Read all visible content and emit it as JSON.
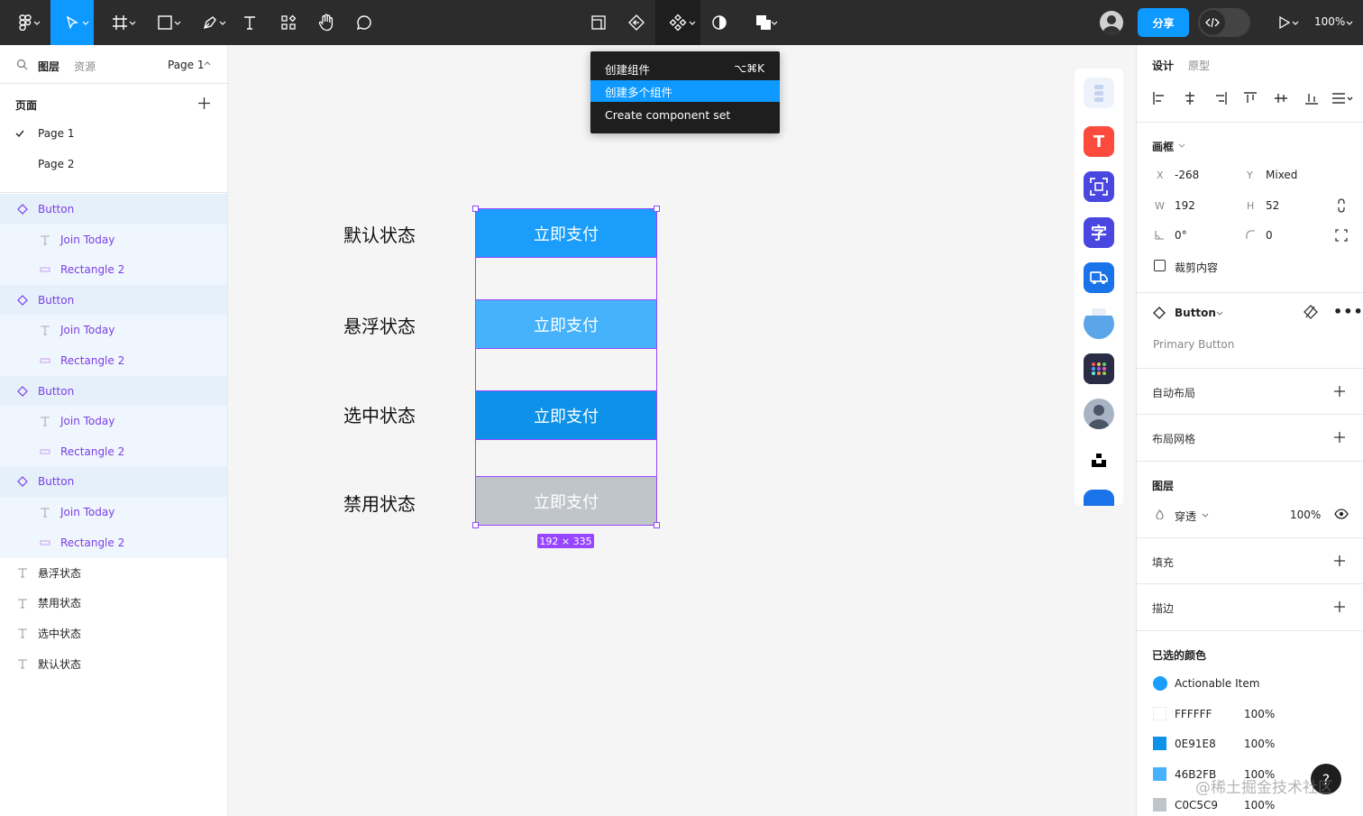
{
  "toolbar": {
    "share_label": "分享",
    "zoom": "100%"
  },
  "menu": {
    "items": [
      {
        "label": "创建组件",
        "shortcut": "⌥⌘K"
      },
      {
        "label": "创建多个组件",
        "shortcut": ""
      },
      {
        "label": "Create component set",
        "shortcut": ""
      }
    ]
  },
  "left_panel": {
    "tabs": [
      "图层",
      "资源"
    ],
    "page_selector": "Page 1",
    "pages_title": "页面",
    "pages": [
      "Page 1",
      "Page 2"
    ],
    "layers": [
      {
        "label": "Button",
        "kind": "component"
      },
      {
        "label": "Join Today",
        "kind": "text-child"
      },
      {
        "label": "Rectangle 2",
        "kind": "rect-child"
      },
      {
        "label": "Button",
        "kind": "component"
      },
      {
        "label": "Join Today",
        "kind": "text-child"
      },
      {
        "label": "Rectangle 2",
        "kind": "rect-child"
      },
      {
        "label": "Button",
        "kind": "component"
      },
      {
        "label": "Join Today",
        "kind": "text-child"
      },
      {
        "label": "Rectangle 2",
        "kind": "rect-child"
      },
      {
        "label": "Button",
        "kind": "component"
      },
      {
        "label": "Join Today",
        "kind": "text-child"
      },
      {
        "label": "Rectangle 2",
        "kind": "rect-child"
      },
      {
        "label": "悬浮状态",
        "kind": "text"
      },
      {
        "label": "禁用状态",
        "kind": "text"
      },
      {
        "label": "选中状态",
        "kind": "text"
      },
      {
        "label": "默认状态",
        "kind": "text"
      }
    ]
  },
  "canvas": {
    "states": [
      {
        "label": "默认状态",
        "button": "立即支付",
        "color": "#1a9dfb"
      },
      {
        "label": "悬浮状态",
        "button": "立即支付",
        "color": "#46b2fb"
      },
      {
        "label": "选中状态",
        "button": "立即支付",
        "color": "#0e91e8"
      },
      {
        "label": "禁用状态",
        "button": "立即支付",
        "color": "#c0c5c9"
      }
    ],
    "size_badge": "192 × 335",
    "selection_color": "#9747ff"
  },
  "right_panel": {
    "tabs": [
      "设计",
      "原型"
    ],
    "frame_title": "画框",
    "x_key": "X",
    "x_val": "-268",
    "y_key": "Y",
    "y_val": "Mixed",
    "w_key": "W",
    "w_val": "192",
    "h_key": "H",
    "h_val": "52",
    "rotation": "0°",
    "radius": "0",
    "clip_label": "裁剪内容",
    "component_name": "Button",
    "component_desc": "Primary Button",
    "auto_layout": "自动布局",
    "layout_grid": "布局网格",
    "layer_title": "图层",
    "blend_mode": "穿透",
    "opacity": "100%",
    "fill_title": "填充",
    "stroke_title": "描边",
    "selected_colors_title": "已选的颜色",
    "colors": [
      {
        "name": "Actionable Item",
        "hex": "#1a9dfb",
        "pct": ""
      },
      {
        "name": "FFFFFF",
        "hex": "#ffffff",
        "pct": "100%"
      },
      {
        "name": "0E91E8",
        "hex": "#0e91e8",
        "pct": "100%"
      },
      {
        "name": "46B2FB",
        "hex": "#46b2fb",
        "pct": "100%"
      },
      {
        "name": "C0C5C9",
        "hex": "#c0c5c9",
        "pct": "100%"
      }
    ]
  },
  "help": "?",
  "watermark": "@稀土掘金技术社区"
}
